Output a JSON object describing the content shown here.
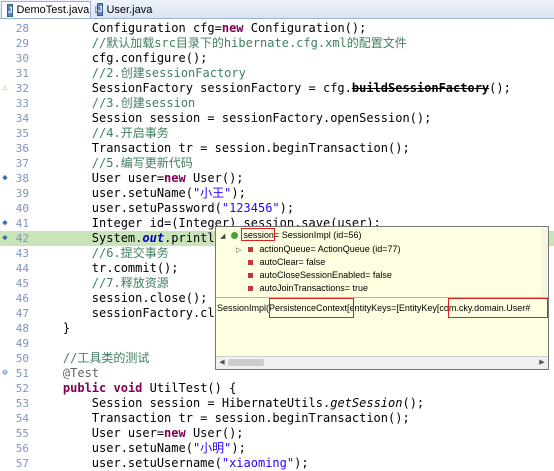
{
  "tabs": [
    {
      "label": "DemoTest.java",
      "close": "☒"
    },
    {
      "label": "User.java"
    }
  ],
  "editor": {
    "lines": [
      {
        "n": "28",
        "m": "",
        "hl": false,
        "html": "        Configuration cfg=<span class=\"kw\">new</span> Configuration();"
      },
      {
        "n": "29",
        "m": "",
        "hl": false,
        "html": "        <span class=\"cm\">//默认加载src目录下的hibernate.cfg.xml的配置文件</span>"
      },
      {
        "n": "30",
        "m": "",
        "hl": false,
        "html": "        cfg.configure();"
      },
      {
        "n": "31",
        "m": "",
        "hl": false,
        "html": "        <span class=\"cm\">//2.创建sessionFactory</span>"
      },
      {
        "n": "32",
        "m": "warn",
        "hl": false,
        "html": "        SessionFactory sessionFactory = cfg.<span class=\"strike\">buildSessionFactory</span>();"
      },
      {
        "n": "33",
        "m": "",
        "hl": false,
        "html": "        <span class=\"cm\">//3.创建session</span>"
      },
      {
        "n": "34",
        "m": "",
        "hl": false,
        "html": "        Session session = sessionFactory.openSession();"
      },
      {
        "n": "35",
        "m": "",
        "hl": false,
        "html": "        <span class=\"cm\">//4.开启事务</span>"
      },
      {
        "n": "36",
        "m": "",
        "hl": false,
        "html": "        Transaction tr = session.beginTransaction();"
      },
      {
        "n": "37",
        "m": "",
        "hl": false,
        "html": "        <span class=\"cm\">//5.编写更新代码</span>"
      },
      {
        "n": "38",
        "m": "dot",
        "hl": false,
        "html": "        User user=<span class=\"kw\">new</span> User();"
      },
      {
        "n": "39",
        "m": "",
        "hl": false,
        "html": "        user.setuName(<span class=\"str\">\"小王\"</span>);"
      },
      {
        "n": "40",
        "m": "",
        "hl": false,
        "html": "        user.setuPassword(<span class=\"str\">\"123456\"</span>);"
      },
      {
        "n": "41",
        "m": "dot",
        "hl": false,
        "html": "        Integer id=(Integer) session.save(user);"
      },
      {
        "n": "42",
        "m": "dot",
        "hl": true,
        "html": "        System.<span class=\"fldi\">out</span>.println(id"
      },
      {
        "n": "43",
        "m": "",
        "hl": false,
        "html": "        <span class=\"cm\">//6.提交事务</span>"
      },
      {
        "n": "44",
        "m": "",
        "hl": false,
        "html": "        tr.commit();"
      },
      {
        "n": "45",
        "m": "",
        "hl": false,
        "html": "        <span class=\"cm\">//7.释放资源</span>"
      },
      {
        "n": "46",
        "m": "",
        "hl": false,
        "html": "        session.close();"
      },
      {
        "n": "47",
        "m": "",
        "hl": false,
        "html": "        sessionFactory.close("
      },
      {
        "n": "48",
        "m": "",
        "hl": false,
        "html": "    }"
      },
      {
        "n": "49",
        "m": "",
        "hl": false,
        "html": ""
      },
      {
        "n": "50",
        "m": "",
        "hl": false,
        "html": "    <span class=\"cm\">//工具类的测试</span>"
      },
      {
        "n": "51",
        "m": "fold",
        "hl": false,
        "html": "    <span class=\"ann\">@Test</span>"
      },
      {
        "n": "52",
        "m": "",
        "hl": false,
        "html": "    <span class=\"kw\">public</span> <span class=\"kw\">void</span> UtilTest() {"
      },
      {
        "n": "53",
        "m": "",
        "hl": false,
        "html": "        Session session = HibernateUtils.<span class=\"mi\">getSession</span>();"
      },
      {
        "n": "54",
        "m": "",
        "hl": false,
        "html": "        Transaction tr = session.beginTransaction();"
      },
      {
        "n": "55",
        "m": "",
        "hl": false,
        "html": "        User user=<span class=\"kw\">new</span> User();"
      },
      {
        "n": "56",
        "m": "",
        "hl": false,
        "html": "        user.setuName(<span class=\"str\">\"小明\"</span>);"
      },
      {
        "n": "57",
        "m": "",
        "hl": false,
        "html": "        user.setuUsername(<span class=\"str\">\"xiaoming\"</span>);"
      }
    ]
  },
  "popup": {
    "root": {
      "name": "session",
      "value": "= SessionImpl  (id=56)"
    },
    "children": [
      {
        "text": "actionQueue= ActionQueue  (id=77)",
        "dot": "red",
        "expand": "▷"
      },
      {
        "text": "autoClear= false",
        "dot": "red"
      },
      {
        "text": "autoCloseSessionEnabled= false",
        "dot": "red"
      },
      {
        "text": "autoJoinTransactions= true",
        "dot": "red"
      }
    ],
    "detail": "SessionImpl(PersistenceContext[entityKeys=[EntityKey[com.cky.domain.User#"
  }
}
